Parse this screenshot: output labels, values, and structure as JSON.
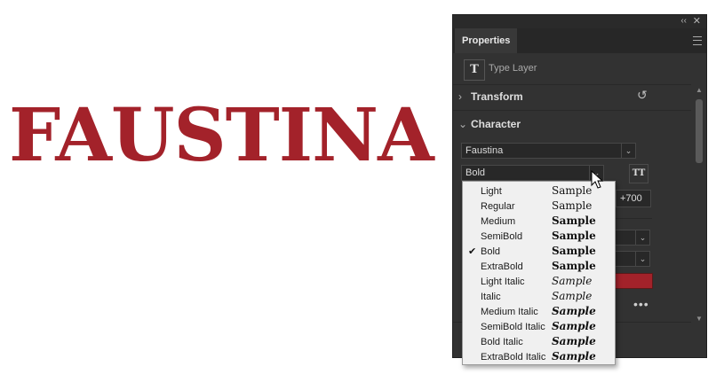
{
  "canvas": {
    "text": "FAUSTINA",
    "color": "#a3222a"
  },
  "panel": {
    "topbar": {
      "collapse": "‹‹",
      "close": "✕"
    },
    "tab": "Properties",
    "layer": {
      "icon": "T",
      "label": "Type Layer"
    },
    "sections": {
      "transform": "Transform",
      "character": "Character"
    },
    "font_family": "Faustina",
    "font_style": "Bold",
    "tracking_value": "+700",
    "partial_value": ")",
    "tt_button": "TT",
    "more_dots": "•••"
  },
  "dropdown": {
    "items": [
      {
        "label": "Light",
        "sample": "Sample",
        "weight": "300",
        "italic": false,
        "checked": false
      },
      {
        "label": "Regular",
        "sample": "Sample",
        "weight": "400",
        "italic": false,
        "checked": false
      },
      {
        "label": "Medium",
        "sample": "Sample",
        "weight": "500",
        "italic": false,
        "checked": false
      },
      {
        "label": "SemiBold",
        "sample": "Sample",
        "weight": "600",
        "italic": false,
        "checked": false
      },
      {
        "label": "Bold",
        "sample": "Sample",
        "weight": "700",
        "italic": false,
        "checked": true
      },
      {
        "label": "ExtraBold",
        "sample": "Sample",
        "weight": "800",
        "italic": false,
        "checked": false
      },
      {
        "label": "Light Italic",
        "sample": "Sample",
        "weight": "300",
        "italic": true,
        "checked": false
      },
      {
        "label": "Italic",
        "sample": "Sample",
        "weight": "400",
        "italic": true,
        "checked": false
      },
      {
        "label": "Medium Italic",
        "sample": "Sample",
        "weight": "500",
        "italic": true,
        "checked": false
      },
      {
        "label": "SemiBold Italic",
        "sample": "Sample",
        "weight": "600",
        "italic": true,
        "checked": false
      },
      {
        "label": "Bold Italic",
        "sample": "Sample",
        "weight": "700",
        "italic": true,
        "checked": false
      },
      {
        "label": "ExtraBold Italic",
        "sample": "Sample",
        "weight": "800",
        "italic": true,
        "checked": false
      }
    ]
  }
}
